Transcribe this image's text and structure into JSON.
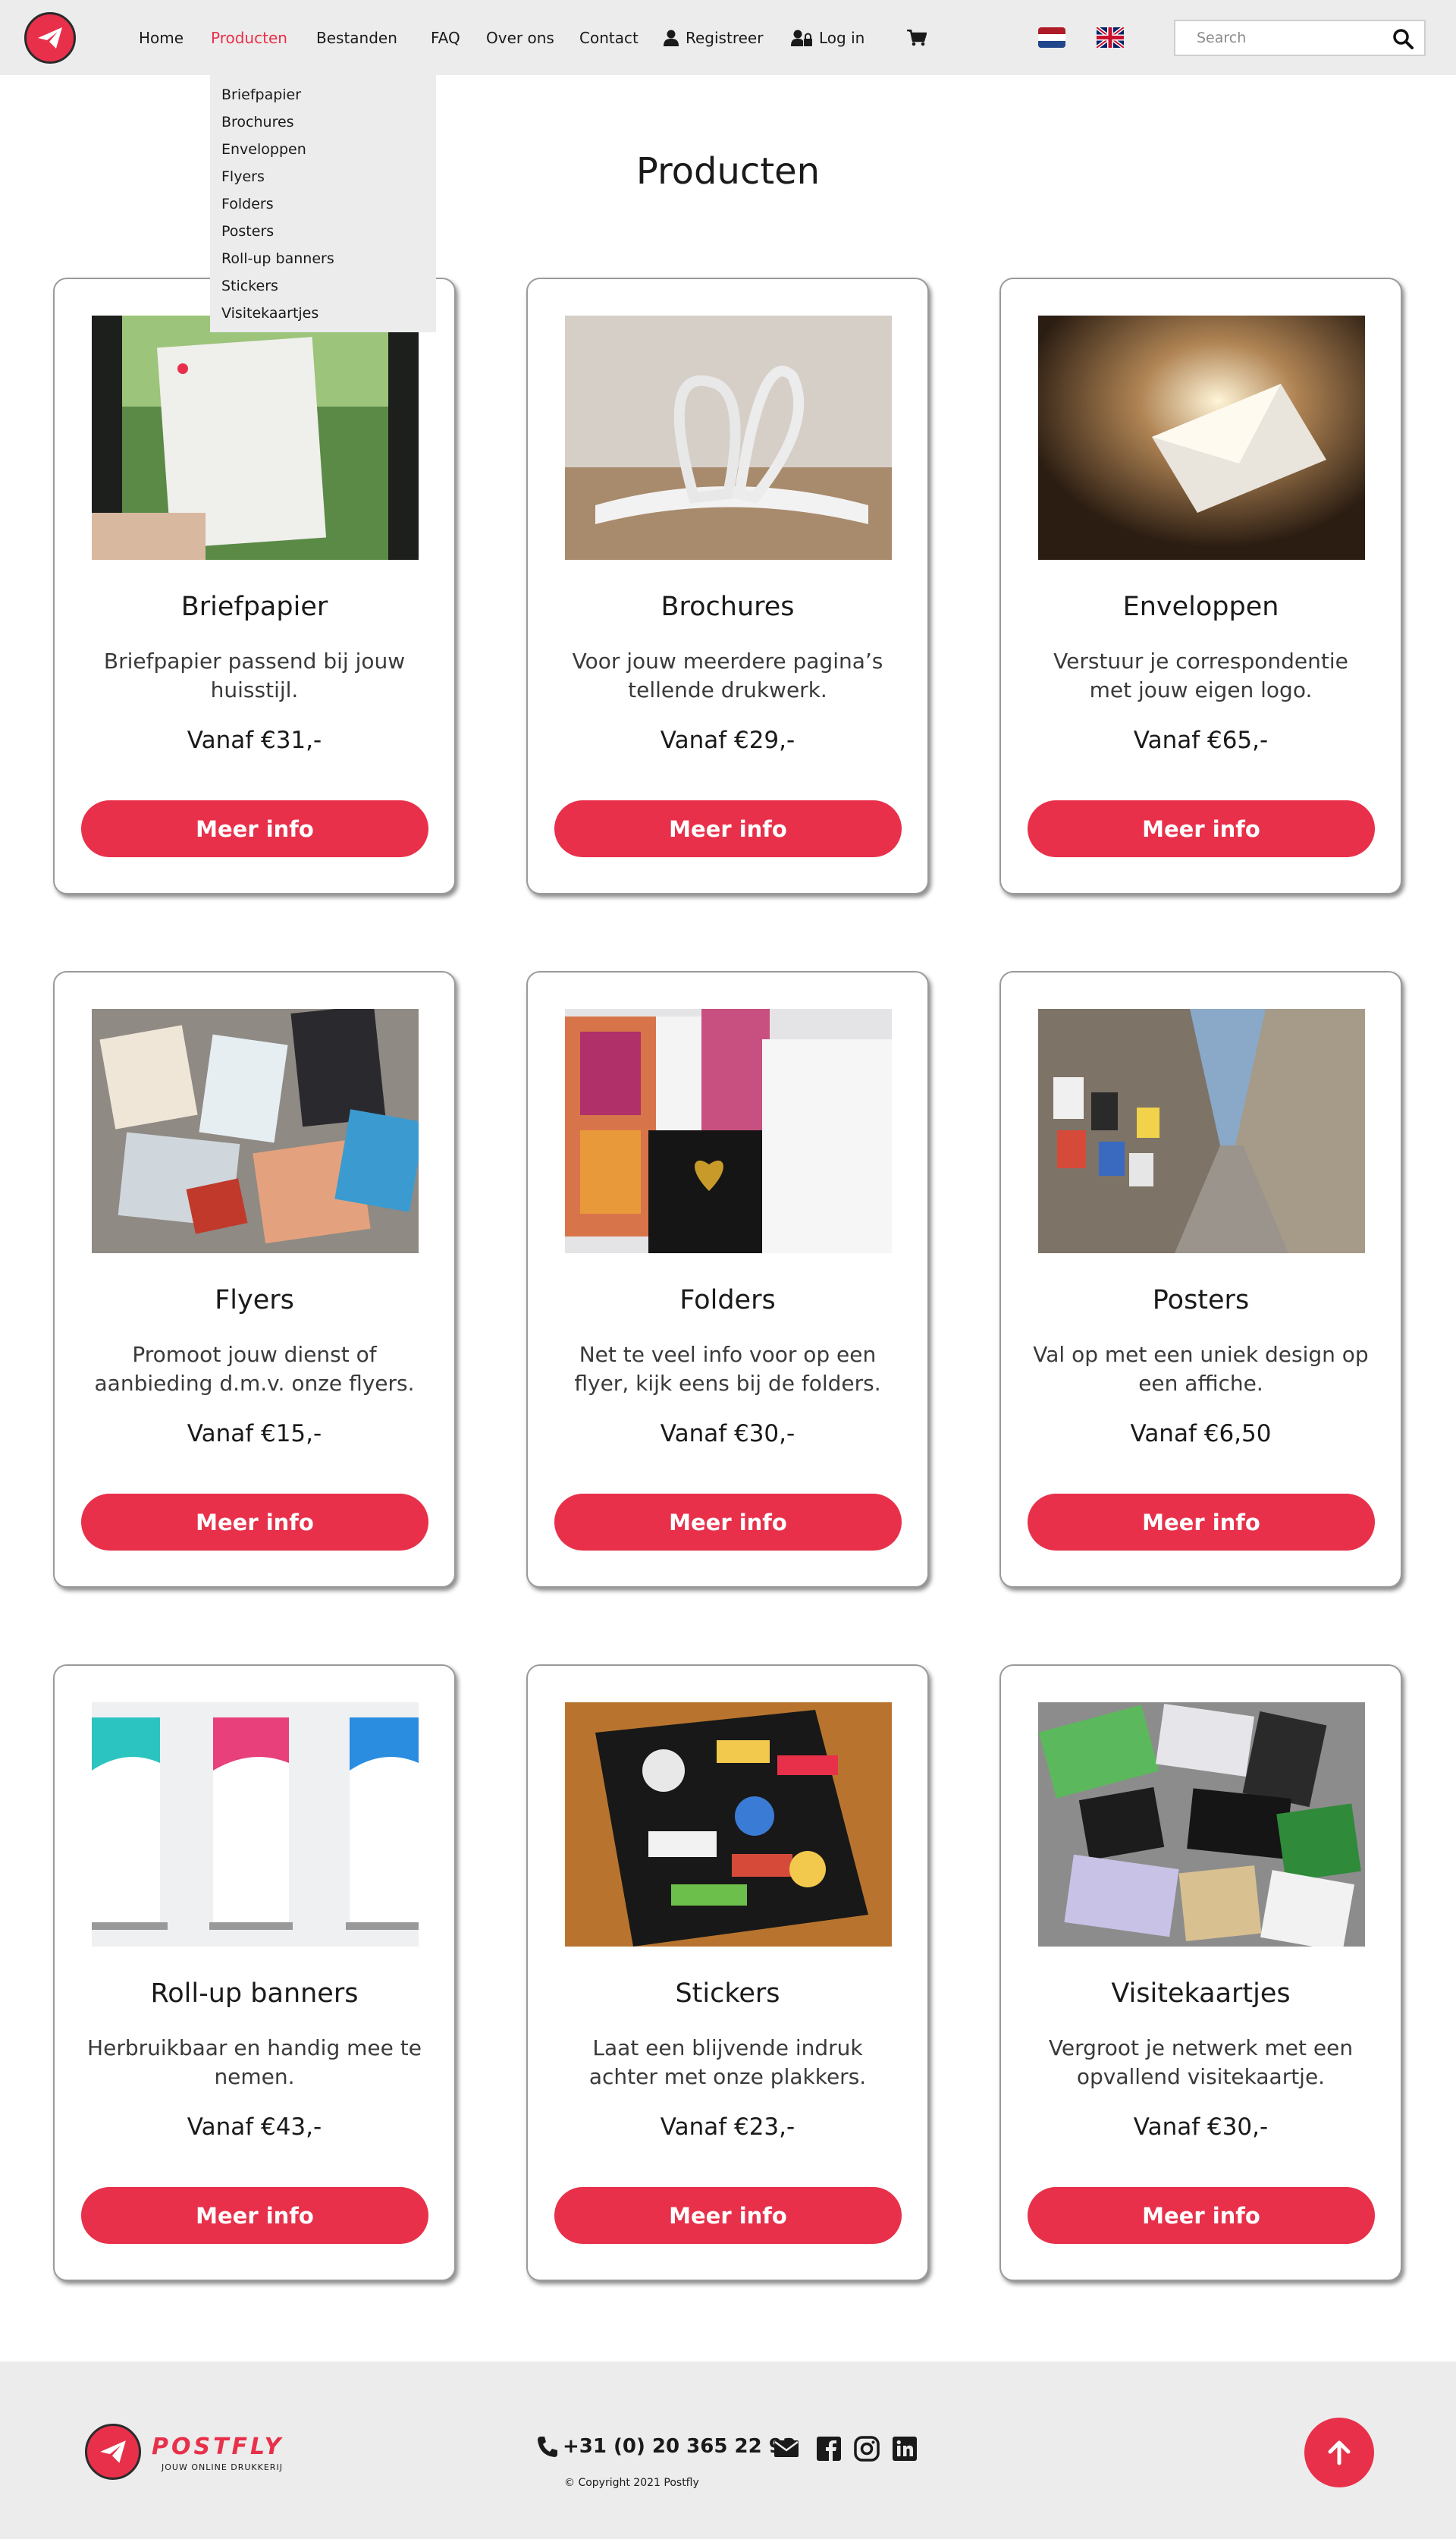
{
  "nav": {
    "links": [
      "Home",
      "Producten",
      "Bestanden",
      "FAQ",
      "Over ons",
      "Contact"
    ],
    "register": "Registreer",
    "login": "Log in",
    "search_placeholder": "Search",
    "icons": [
      "paper-plane-logo",
      "user-icon",
      "user-lock-icon",
      "cart-icon",
      "flag-nl-icon",
      "flag-uk-icon",
      "search-icon"
    ]
  },
  "dropdown": {
    "items": [
      "Briefpapier",
      "Brochures",
      "Enveloppen",
      "Flyers",
      "Folders",
      "Posters",
      "Roll-up banners",
      "Stickers",
      "Visitekaartjes"
    ]
  },
  "page": {
    "title": "Producten"
  },
  "products": [
    {
      "name": "Briefpapier",
      "description": "Briefpapier passend bij jouw huisstijl.",
      "price": "Vanaf €31,-",
      "button": "Meer info"
    },
    {
      "name": "Brochures",
      "description": "Voor jouw meerdere pagina’s tellende drukwerk.",
      "price": "Vanaf €29,-",
      "button": "Meer info"
    },
    {
      "name": "Enveloppen",
      "description": "Verstuur je correspondentie met jouw eigen logo.",
      "price": "Vanaf €65,-",
      "button": "Meer info"
    },
    {
      "name": "Flyers",
      "description": "Promoot jouw dienst of aanbieding d.m.v. onze flyers.",
      "price": "Vanaf €15,-",
      "button": "Meer info"
    },
    {
      "name": "Folders",
      "description": "Net te veel info voor op een flyer, kijk eens bij de folders.",
      "price": "Vanaf €30,-",
      "button": "Meer info"
    },
    {
      "name": "Posters",
      "description": "Val op met een uniek design op een affiche.",
      "price": "Vanaf €6,50",
      "button": "Meer info"
    },
    {
      "name": "Roll-up banners",
      "description": "Herbruikbaar en handig mee te nemen.",
      "price": "Vanaf €43,-",
      "button": "Meer info"
    },
    {
      "name": "Stickers",
      "description": "Laat een blijvende indruk achter met onze plakkers.",
      "price": "Vanaf €23,-",
      "button": "Meer info"
    },
    {
      "name": "Visitekaartjes",
      "description": "Vergroot je netwerk met een opvallend visitekaartje.",
      "price": "Vanaf €30,-",
      "button": "Meer info"
    }
  ],
  "footer": {
    "brand": "POSTFLY",
    "tagline": "JOUW ONLINE DRUKKERIJ",
    "phone": "+31 (0) 20 365 22 93",
    "copyright": "© Copyright 2021 Postfly",
    "social_icons": [
      "envelope-icon",
      "facebook-icon",
      "instagram-icon",
      "linkedin-icon"
    ]
  },
  "colors": {
    "accent": "#e8304a",
    "nav_bg": "#ececec",
    "text": "#1a1a1a"
  }
}
